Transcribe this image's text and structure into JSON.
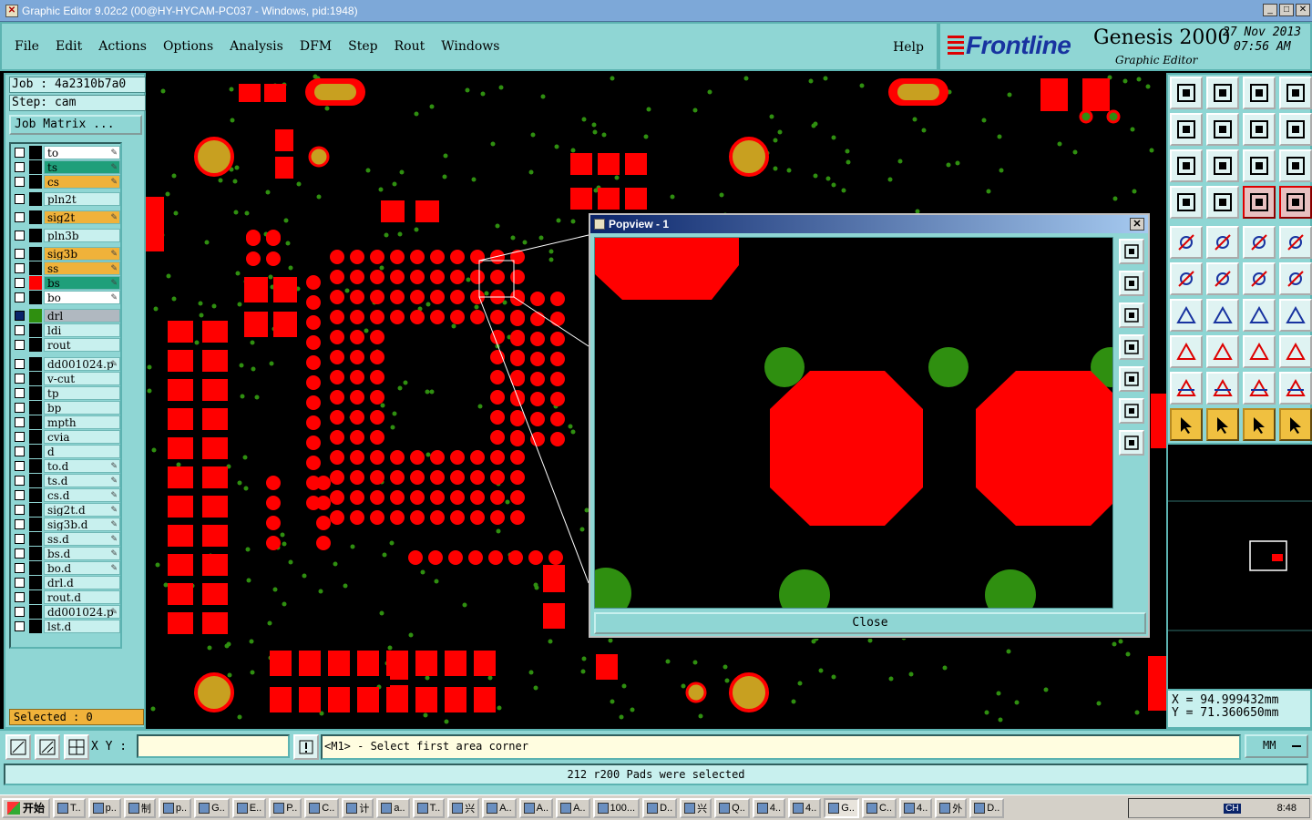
{
  "window": {
    "title": "Graphic Editor 9.02c2 (00@HY-HYCAM-PC037 - Windows, pid:1948)"
  },
  "menu": {
    "items": [
      {
        "label": "File",
        "key": "F"
      },
      {
        "label": "Edit",
        "key": "E"
      },
      {
        "label": "Actions",
        "key": "A"
      },
      {
        "label": "Options",
        "key": "O"
      },
      {
        "label": "Analysis",
        "key": "n"
      },
      {
        "label": "DFM",
        "key": "D"
      },
      {
        "label": "Step",
        "key": "S"
      },
      {
        "label": "Rout",
        "key": "R"
      },
      {
        "label": "Windows",
        "key": "W"
      }
    ],
    "help": "Help"
  },
  "brand": {
    "logo": "Frontline",
    "product": "Genesis 2000",
    "subtitle": "Graphic Editor",
    "date": "27 Nov 2013",
    "time": "07:56 AM"
  },
  "job": {
    "job_line": "Job : 4a2310b7a0",
    "step_line": "Step: cam",
    "matrix_button": "Job Matrix ..."
  },
  "layers": [
    {
      "name": "to",
      "color": "#ffffff",
      "pen": true
    },
    {
      "name": "ts",
      "color": "#1f9f7a",
      "pen": true
    },
    {
      "name": "cs",
      "color": "#f0b23a",
      "pen": true
    },
    {
      "name": "pln2t",
      "color": "#c8f0ee",
      "pen": false
    },
    {
      "name": "sig2t",
      "color": "#f0b23a",
      "pen": true
    },
    {
      "name": "pln3b",
      "color": "#c8f0ee",
      "pen": false
    },
    {
      "name": "sig3b",
      "color": "#f0b23a",
      "pen": true
    },
    {
      "name": "ss",
      "color": "#f0b23a",
      "pen": true
    },
    {
      "name": "bs",
      "color": "#1f9f7a",
      "pen": true
    },
    {
      "name": "bo",
      "color": "#ffffff",
      "pen": true
    },
    {
      "name": "drl",
      "color": "#b0b8c0",
      "pen": false
    },
    {
      "name": "ldi",
      "color": "#c8f0ee",
      "pen": false
    },
    {
      "name": "rout",
      "color": "#c8f0ee",
      "pen": false
    },
    {
      "name": "dd001024.p",
      "color": "#c8f0ee",
      "pen": true
    },
    {
      "name": "v-cut",
      "color": "#c8f0ee",
      "pen": false
    },
    {
      "name": "tp",
      "color": "#c8f0ee",
      "pen": false
    },
    {
      "name": "bp",
      "color": "#c8f0ee",
      "pen": false
    },
    {
      "name": "mpth",
      "color": "#c8f0ee",
      "pen": false
    },
    {
      "name": "cvia",
      "color": "#c8f0ee",
      "pen": false
    },
    {
      "name": "d",
      "color": "#c8f0ee",
      "pen": false
    },
    {
      "name": "to.d",
      "color": "#c8f0ee",
      "pen": true
    },
    {
      "name": "ts.d",
      "color": "#c8f0ee",
      "pen": true
    },
    {
      "name": "cs.d",
      "color": "#c8f0ee",
      "pen": true
    },
    {
      "name": "sig2t.d",
      "color": "#c8f0ee",
      "pen": true
    },
    {
      "name": "sig3b.d",
      "color": "#c8f0ee",
      "pen": true
    },
    {
      "name": "ss.d",
      "color": "#c8f0ee",
      "pen": true
    },
    {
      "name": "bs.d",
      "color": "#c8f0ee",
      "pen": true
    },
    {
      "name": "bo.d",
      "color": "#c8f0ee",
      "pen": true
    },
    {
      "name": "drl.d",
      "color": "#c8f0ee",
      "pen": false
    },
    {
      "name": "rout.d",
      "color": "#c8f0ee",
      "pen": false
    },
    {
      "name": "dd001024.p",
      "color": "#c8f0ee",
      "pen": true
    },
    {
      "name": "lst.d",
      "color": "#c8f0ee",
      "pen": false
    }
  ],
  "selected": "Selected : 0",
  "popview": {
    "title": "Popview - 1",
    "close": "Close"
  },
  "coords": {
    "x": "X  =  94.999432mm",
    "y": "Y  =  71.360650mm"
  },
  "command": {
    "xy_label": "X Y :",
    "xy_value": "",
    "prompt": "<M1> - Select first area corner",
    "units": "MM"
  },
  "status": "212 r200 Pads were selected",
  "taskbar": {
    "start": "开始",
    "tasks": [
      "T..",
      "p..",
      "制",
      "p..",
      "G..",
      "E..",
      "P..",
      "C..",
      "计",
      "a..",
      "T..",
      "兴",
      "A..",
      "A..",
      "A..",
      "100...",
      "D..",
      "兴",
      "Q..",
      "4..",
      "4..",
      "G..",
      "C..",
      "4..",
      "外",
      "D.."
    ],
    "lang": "CH",
    "clock": "8:48"
  },
  "colors": {
    "panel": "#8fd6d4",
    "pad_red": "#ff0000",
    "via_green": "#2f8f10",
    "hole_gold": "#c8a020"
  }
}
